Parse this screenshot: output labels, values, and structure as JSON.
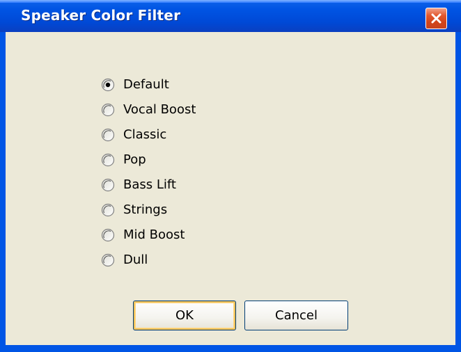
{
  "window": {
    "title": "Speaker Color Filter"
  },
  "options": {
    "selected_index": 0,
    "items": [
      {
        "label": "Default",
        "checked": true
      },
      {
        "label": "Vocal Boost",
        "checked": false
      },
      {
        "label": "Classic",
        "checked": false
      },
      {
        "label": "Pop",
        "checked": false
      },
      {
        "label": "Bass Lift",
        "checked": false
      },
      {
        "label": "Strings",
        "checked": false
      },
      {
        "label": "Mid Boost",
        "checked": false
      },
      {
        "label": "Dull",
        "checked": false
      }
    ]
  },
  "buttons": {
    "ok_label": "OK",
    "cancel_label": "Cancel"
  },
  "icons": {
    "close": "close-icon",
    "radio_checked": "radio-checked-icon",
    "radio_unchecked": "radio-unchecked-icon"
  },
  "colors": {
    "titlebar": "#0054e3",
    "dialog_background": "#ece9d8",
    "close_button": "#e3592f",
    "title_text": "#ffffff"
  }
}
